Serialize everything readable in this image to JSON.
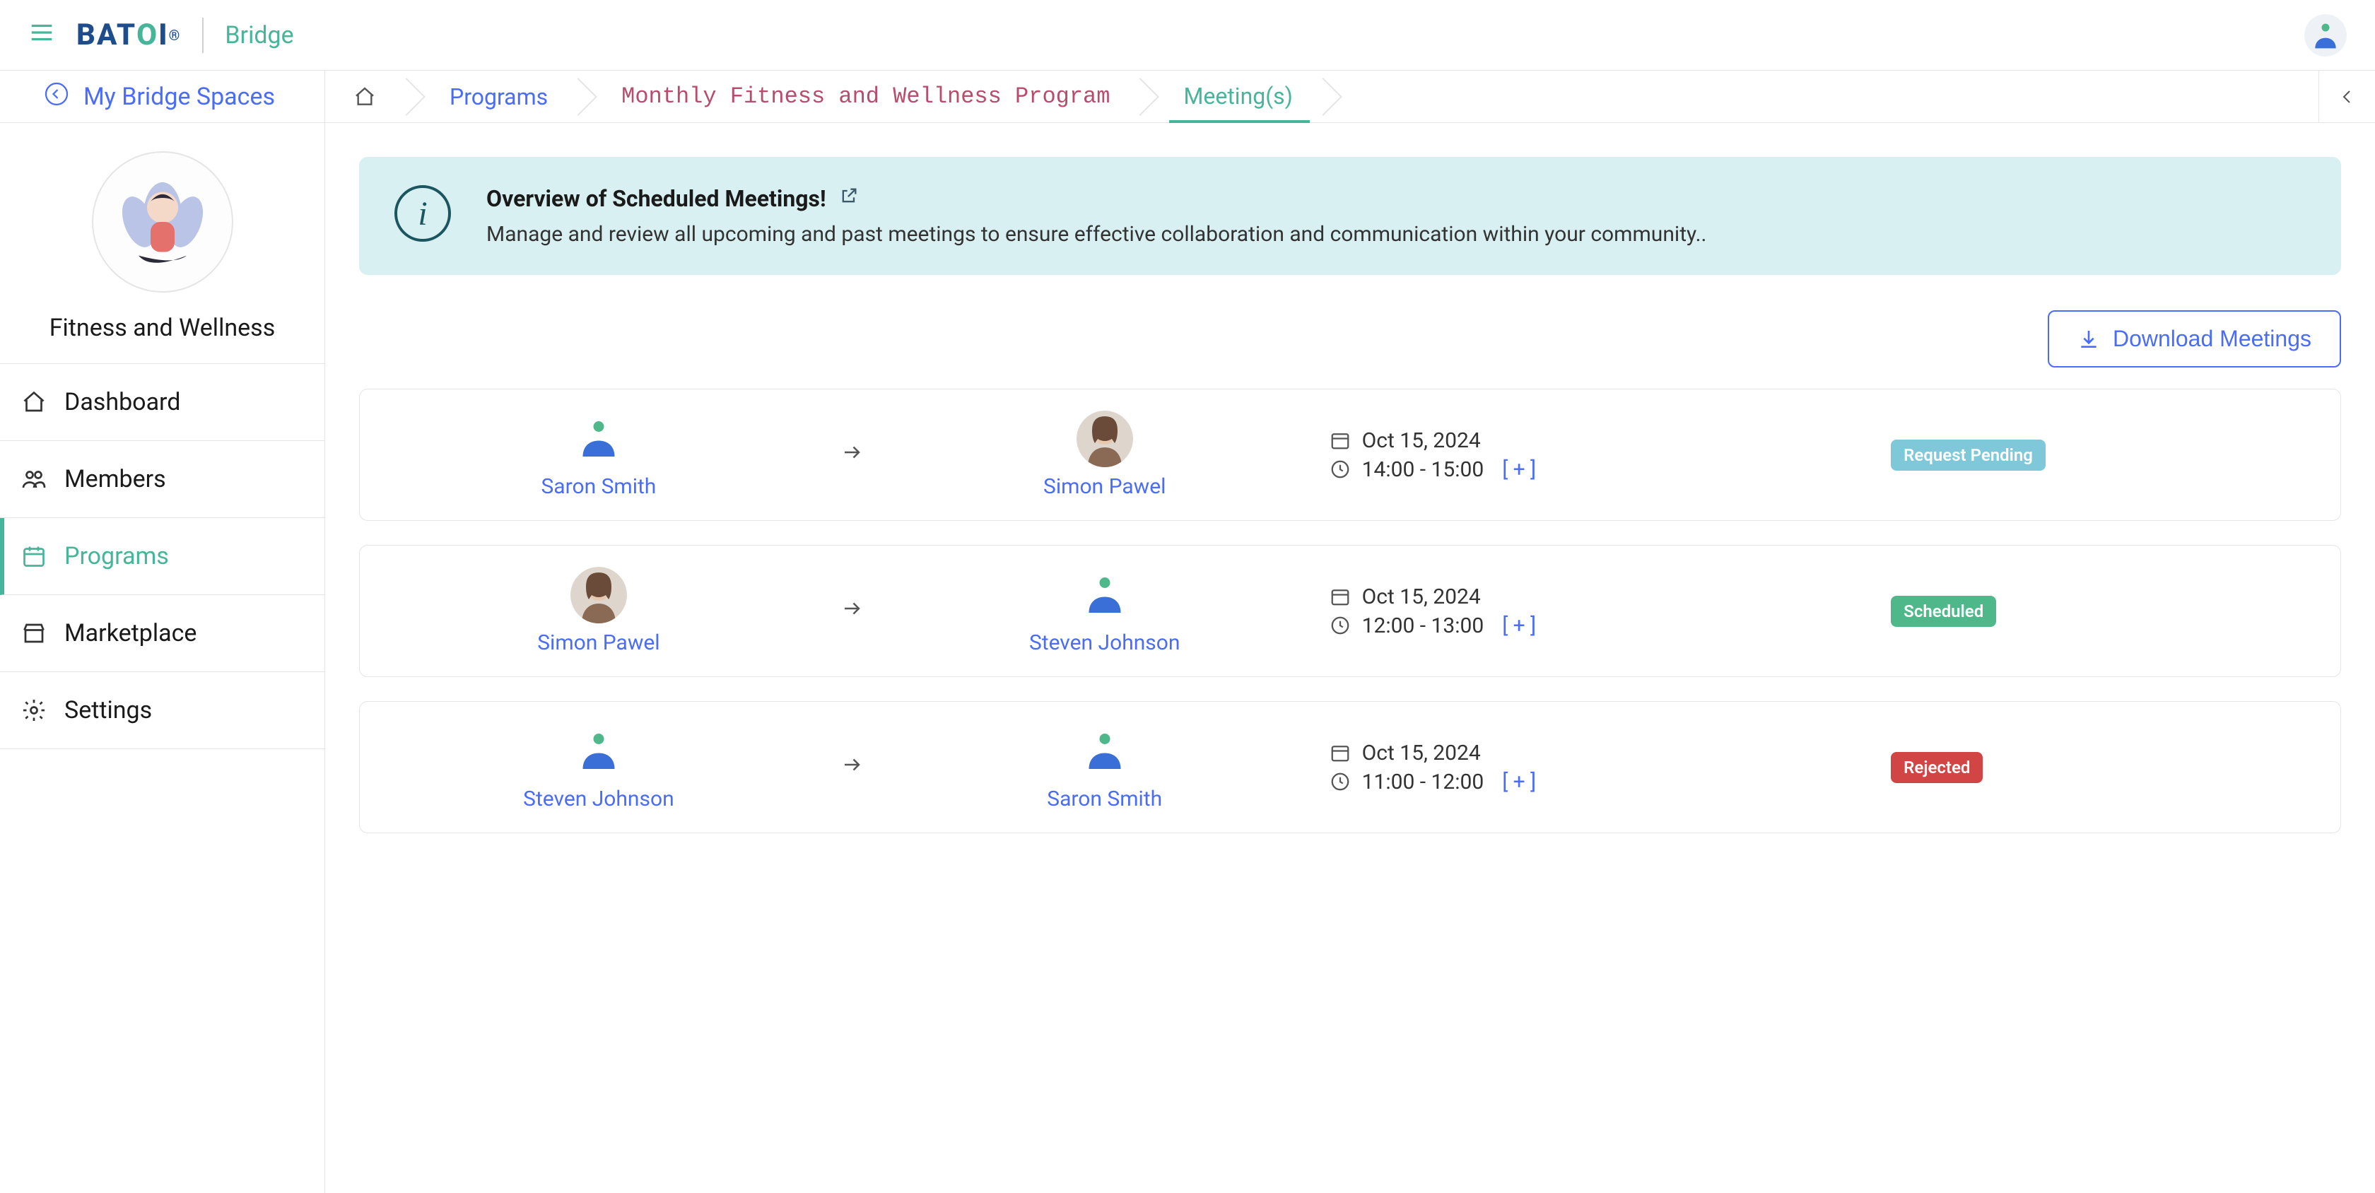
{
  "brand": {
    "bridge": "Bridge"
  },
  "header": {
    "my_spaces": "My Bridge Spaces",
    "crumb_programs": "Programs",
    "crumb_program_name": "Monthly Fitness and Wellness Program",
    "crumb_meetings": "Meeting(s)"
  },
  "space": {
    "name": "Fitness and Wellness"
  },
  "nav": {
    "dashboard": "Dashboard",
    "members": "Members",
    "programs": "Programs",
    "marketplace": "Marketplace",
    "settings": "Settings"
  },
  "banner": {
    "title": "Overview of Scheduled Meetings!",
    "desc": "Manage and review all upcoming and past meetings to ensure effective collaboration and communication within your community.."
  },
  "actions": {
    "download": "Download Meetings"
  },
  "plus": "[ + ]",
  "meetings": [
    {
      "from_name": "Saron Smith",
      "from_avatar": "generic",
      "to_name": "Simon Pawel",
      "to_avatar": "photo",
      "date": "Oct 15, 2024",
      "time": "14:00 - 15:00",
      "status_label": "Request Pending",
      "status_class": "pending"
    },
    {
      "from_name": "Simon Pawel",
      "from_avatar": "photo",
      "to_name": "Steven Johnson",
      "to_avatar": "generic",
      "date": "Oct 15, 2024",
      "time": "12:00 - 13:00",
      "status_label": "Scheduled",
      "status_class": "scheduled"
    },
    {
      "from_name": "Steven Johnson",
      "from_avatar": "generic",
      "to_name": "Saron Smith",
      "to_avatar": "generic",
      "date": "Oct 15, 2024",
      "time": "11:00 - 12:00",
      "status_label": "Rejected",
      "status_class": "rejected"
    }
  ]
}
